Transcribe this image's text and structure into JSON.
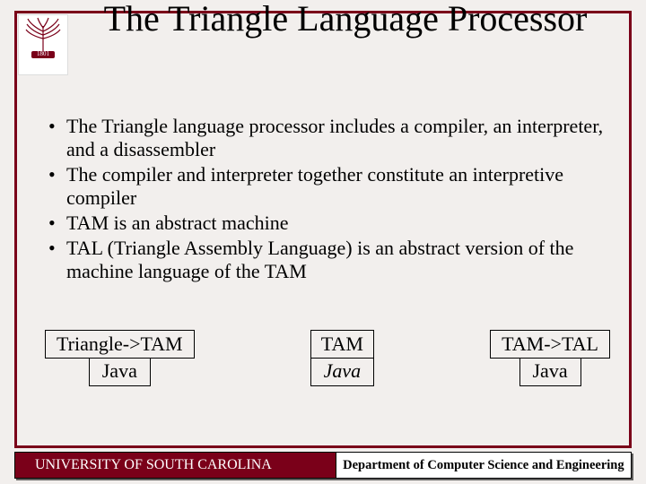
{
  "title": "The Triangle Language Processor",
  "bullets": [
    "The Triangle language processor includes a compiler, an interpreter, and a disassembler",
    "The compiler and interpreter together constitute an interpretive compiler",
    "TAM is an abstract machine",
    "TAL (Triangle Assembly Language) is an abstract version of the machine language of the TAM"
  ],
  "diagrams": {
    "compiler": {
      "top": "Triangle->TAM",
      "bottom": "Java"
    },
    "interpreter": {
      "top": "TAM",
      "bottom": "Java"
    },
    "disassembler": {
      "top": "TAM->TAL",
      "bottom": "Java"
    }
  },
  "footer": {
    "university": "UNIVERSITY OF SOUTH CAROLINA",
    "department": "Department of Computer Science and Engineering"
  },
  "logo": {
    "name": "university-seal-icon",
    "year": "1801"
  },
  "colors": {
    "garnet": "#7a0019",
    "background": "#f2efed"
  }
}
